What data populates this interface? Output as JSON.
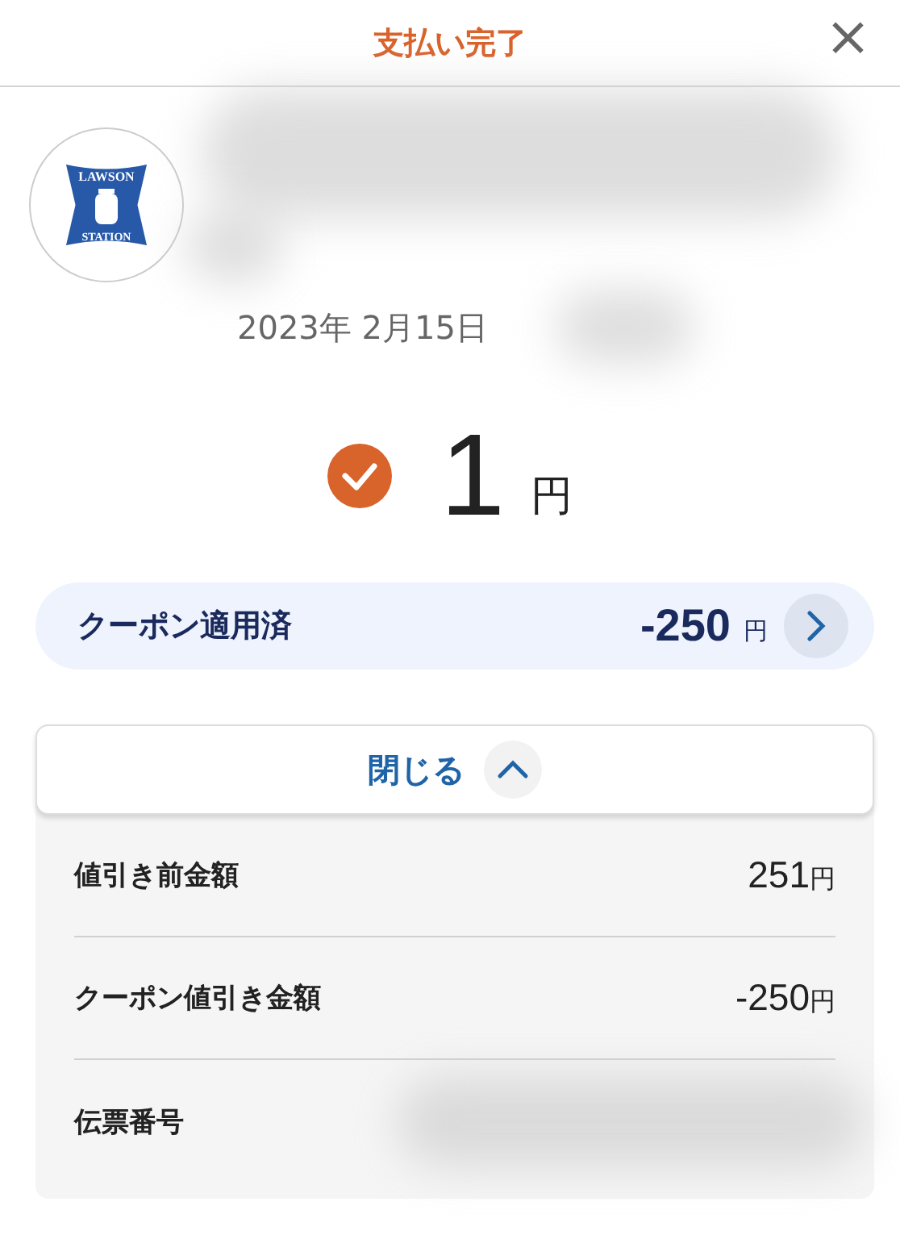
{
  "header": {
    "title": "支払い完了",
    "close": "×"
  },
  "store": {
    "logo_top": "LAWSON",
    "logo_bottom": "STATION"
  },
  "date": "2023年 2月15日",
  "amount": {
    "value": "1",
    "unit": "円"
  },
  "coupon": {
    "label": "クーポン適用済",
    "value": "-250",
    "unit": "円"
  },
  "toggle": {
    "label": "閉じる",
    "expanded": true
  },
  "details": [
    {
      "label": "値引き前金額",
      "value": "251",
      "unit": "円"
    },
    {
      "label": "クーポン値引き金額",
      "value": "-250",
      "unit": "円"
    },
    {
      "label": "伝票番号"
    }
  ]
}
